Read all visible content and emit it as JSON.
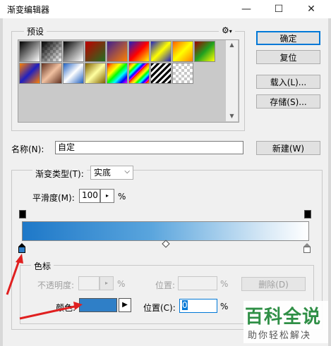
{
  "window": {
    "title": "渐变编辑器"
  },
  "presets": {
    "legend": "预设",
    "gear": "⚙"
  },
  "buttons": {
    "ok": "确定",
    "reset": "复位",
    "load": "载入(L)...",
    "save": "存储(S)...",
    "new": "新建(W)",
    "delete": "删除(D)"
  },
  "name": {
    "label": "名称(N):",
    "value": "自定"
  },
  "gradient_type": {
    "label": "渐变类型(T):",
    "value": "实底"
  },
  "smoothness": {
    "label": "平滑度(M):",
    "value": "100",
    "unit": "%"
  },
  "stops": {
    "legend": "色标",
    "opacity_label": "不透明度:",
    "opacity_unit": "%",
    "location_label_top": "位置:",
    "location_unit_top": "%",
    "color_label": "颜色:",
    "color_value": "#2f7fc7",
    "location_label": "位置(C):",
    "location_value": "0",
    "location_unit": "%"
  },
  "gradient": {
    "color_start": "#1e78c8",
    "color_end": "#ffffff"
  },
  "watermark": {
    "title": "百科全说",
    "subtitle": "助你轻松解决"
  }
}
